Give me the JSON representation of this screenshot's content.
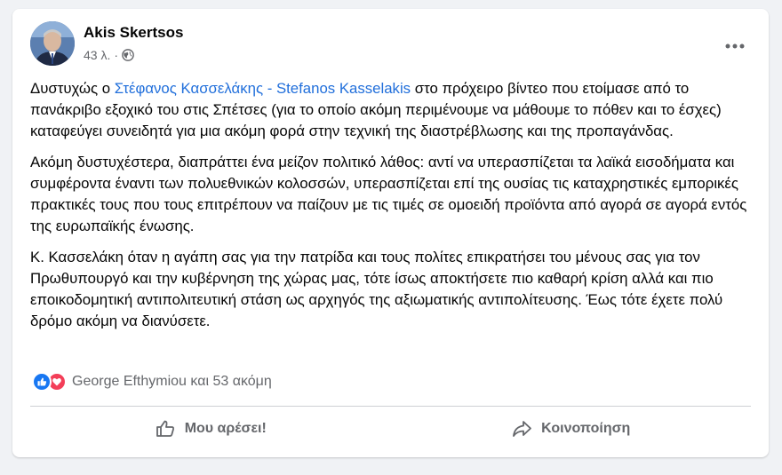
{
  "post": {
    "author": "Akis Skertsos",
    "time": "43 λ.",
    "separator": "·",
    "mention": "Στέφανος Κασσελάκης - Stefanos Kasselakis",
    "paragraph1_prefix": "Δυστυχώς ο ",
    "paragraph1_suffix": " στο πρόχειρο βίντεο που ετοίμασε από το πανάκριβο εξοχικό του στις Σπέτσες (για το οποίο ακόμη περιμένουμε να μάθουμε το πόθεν και το έσχες) καταφεύγει συνειδητά για μια ακόμη φορά στην τεχνική της διαστρέβλωσης και της προπαγάνδας.",
    "paragraph2": "Ακόμη δυστυχέστερα, διαπράττει ένα μείζον πολιτικό λάθος: αντί να υπερασπίζεται τα λαϊκά εισοδήματα και συμφέροντα έναντι των πολυεθνικών κολοσσών, υπερασπίζεται επί της ουσίας τις καταχρηστικές εμπορικές πρακτικές τους που τους επιτρέπουν να παίζουν με τις τιμές σε ομοειδή προϊόντα από αγορά σε αγορά εντός της ευρωπαϊκής ένωσης.",
    "paragraph3": "Κ. Κασσελάκη όταν η αγάπη σας για την πατρίδα και τους πολίτες επικρατήσει του μένους σας για τον Πρωθυπουργό και την κυβέρνηση της χώρας μας, τότε ίσως αποκτήσετε πιο καθαρή κρίση αλλά και πιο εποικοδομητική αντιπολιτευτική στάση ως αρχηγός της αξιωματικής αντιπολίτευσης. Έως τότε έχετε πολύ δρόμο ακόμη να διανύσετε."
  },
  "reactions": {
    "text": "George Efthymiou και 53 ακόμη",
    "icons": [
      "like-icon",
      "love-icon"
    ]
  },
  "actions": {
    "like_label": "Μου αρέσει!",
    "share_label": "Κοινοποίηση"
  },
  "colors": {
    "mention": "#216fdb",
    "like": "#1877f2",
    "love": "#f33e58",
    "secondary_text": "#65676b"
  }
}
